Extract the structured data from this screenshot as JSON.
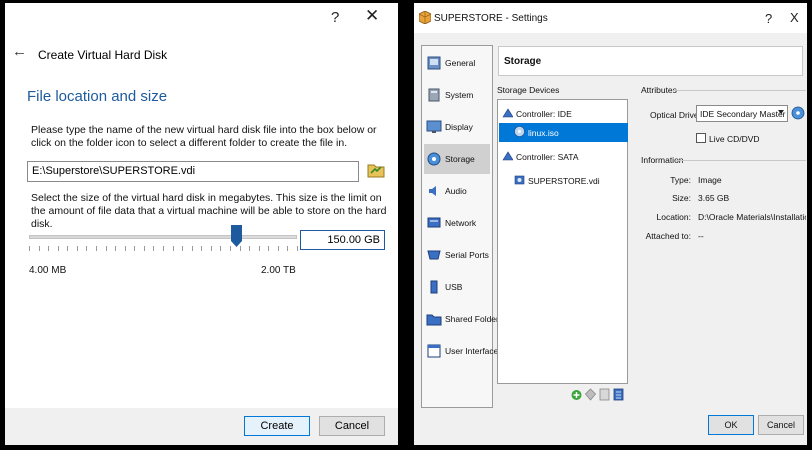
{
  "left_dialog": {
    "help_label": "?",
    "close_label": "✕",
    "back_label": "←",
    "title": "Create Virtual Hard Disk",
    "heading": "File location and size",
    "instructions_1": "Please type the name of the new virtual hard disk file into the box below or click on the folder icon to select a different folder to create the file in.",
    "file_path": "E:\\Superstore\\SUPERSTORE.vdi",
    "instructions_2": "Select the size of the virtual hard disk in megabytes. This size is the limit on the amount of file data that a virtual machine will be able to store on the hard disk.",
    "slider_fraction": 0.77,
    "size_value": "150.00 GB",
    "min_label": "4.00 MB",
    "max_label": "2.00 TB",
    "create_label": "Create",
    "cancel_label": "Cancel",
    "icons": {
      "back": "back-arrow-icon",
      "folder": "folder-icon"
    }
  },
  "right_dialog": {
    "title": "SUPERSTORE - Settings",
    "help_label": "?",
    "close_label": "X",
    "sidebar": [
      {
        "label": "General",
        "icon": "general-icon"
      },
      {
        "label": "System",
        "icon": "system-icon"
      },
      {
        "label": "Display",
        "icon": "display-icon"
      },
      {
        "label": "Storage",
        "icon": "storage-icon",
        "selected": true
      },
      {
        "label": "Audio",
        "icon": "audio-icon"
      },
      {
        "label": "Network",
        "icon": "network-icon"
      },
      {
        "label": "Serial Ports",
        "icon": "serial-ports-icon"
      },
      {
        "label": "USB",
        "icon": "usb-icon"
      },
      {
        "label": "Shared Folders",
        "icon": "shared-folders-icon"
      },
      {
        "label": "User Interface",
        "icon": "user-interface-icon"
      }
    ],
    "section_title": "Storage",
    "storage_devices_label": "Storage Devices",
    "tree": [
      {
        "label": "Controller: IDE",
        "icon": "ide-controller-icon"
      },
      {
        "label": "linux.iso",
        "icon": "optical-disc-icon",
        "selected": true
      },
      {
        "label": "Controller: SATA",
        "icon": "sata-controller-icon"
      },
      {
        "label": "SUPERSTORE.vdi",
        "icon": "hard-disk-icon"
      }
    ],
    "attributes_label": "Attributes",
    "optical_drive_label": "Optical Drive:",
    "optical_drive_value": "IDE Secondary Master",
    "live_cd_label": "Live CD/DVD",
    "live_cd_checked": false,
    "information_label": "Information",
    "info": [
      {
        "key": "Type:",
        "value": "Image"
      },
      {
        "key": "Size:",
        "value": "3.65 GB"
      },
      {
        "key": "Location:",
        "value": "D:\\Oracle Materials\\Installation\\lin..."
      },
      {
        "key": "Attached to:",
        "value": "--"
      }
    ],
    "ok_label": "OK",
    "cancel_label": "Cancel",
    "colors": {
      "selection": "#0078d7",
      "heading_blue": "#1d5a9e"
    }
  }
}
